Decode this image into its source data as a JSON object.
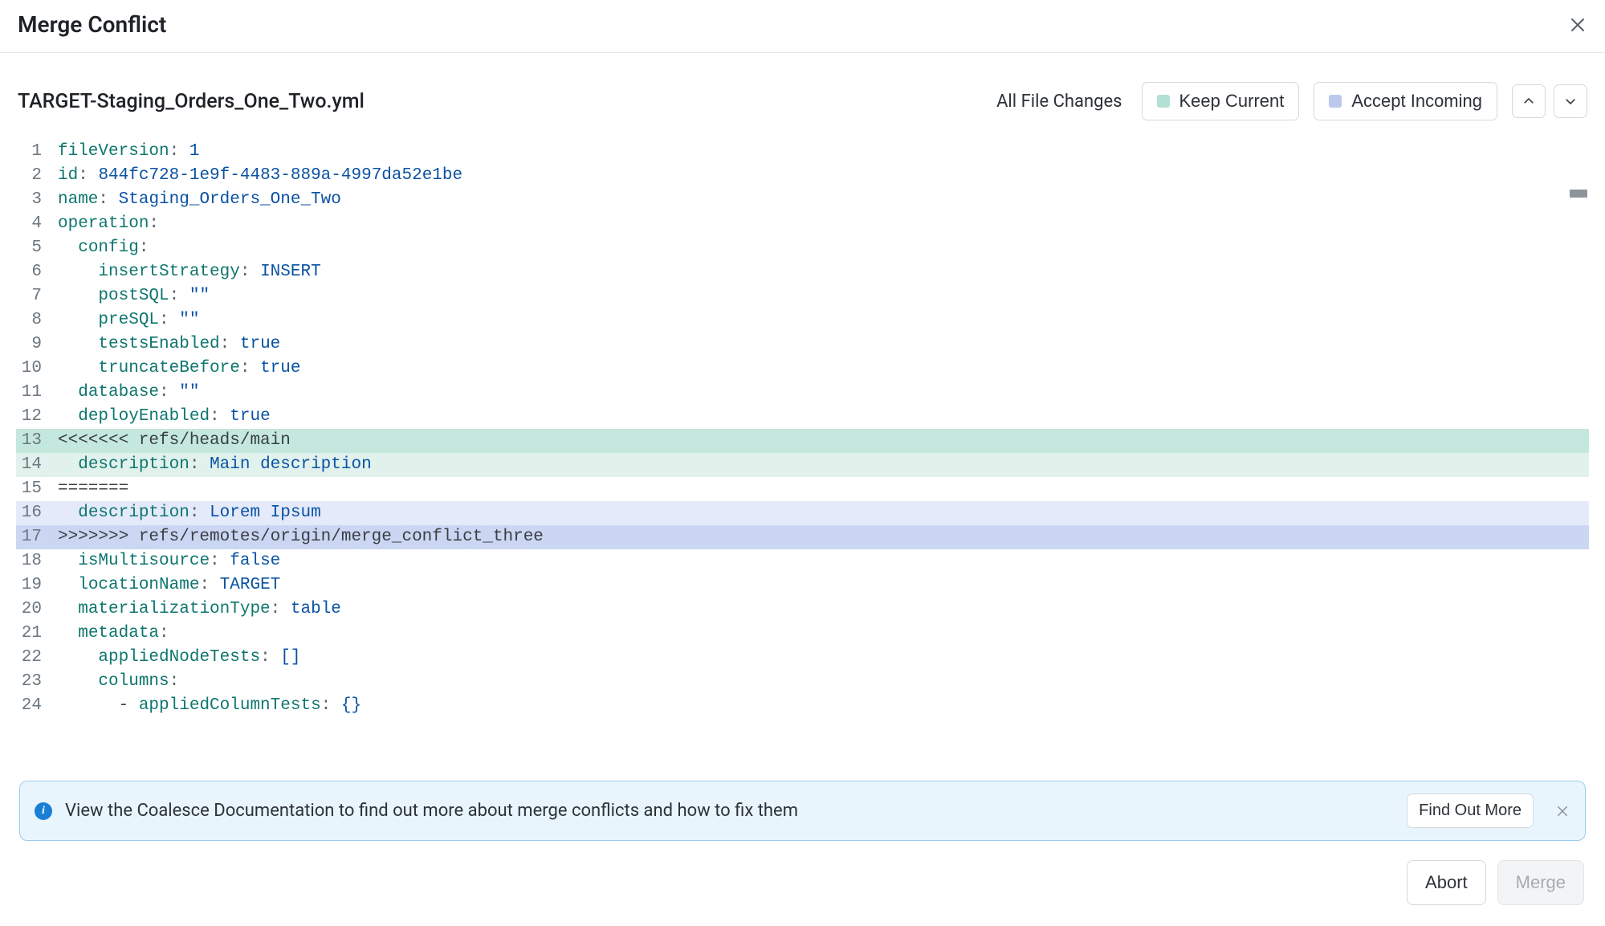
{
  "dialog": {
    "title": "Merge Conflict"
  },
  "file": {
    "name": "TARGET-Staging_Orders_One_Two.yml"
  },
  "actions": {
    "all_file_changes": "All File Changes",
    "keep_current": "Keep Current",
    "accept_incoming": "Accept Incoming"
  },
  "colors": {
    "current_swatch": "#b4dfd4",
    "incoming_swatch": "#bcc9ed",
    "current_head_bg": "#c5e8de",
    "current_body_bg": "#e1f2ed",
    "incoming_body_bg": "#e4eafa",
    "incoming_head_bg": "#cbd6f2"
  },
  "code_lines": [
    {
      "n": 1,
      "hl": "",
      "tokens": [
        [
          "key",
          "fileVersion"
        ],
        [
          "punct",
          ": "
        ],
        [
          "num",
          "1"
        ]
      ]
    },
    {
      "n": 2,
      "hl": "",
      "tokens": [
        [
          "key",
          "id"
        ],
        [
          "punct",
          ": "
        ],
        [
          "val",
          "844fc728-1e9f-4483-889a-4997da52e1be"
        ]
      ]
    },
    {
      "n": 3,
      "hl": "",
      "tokens": [
        [
          "key",
          "name"
        ],
        [
          "punct",
          ": "
        ],
        [
          "val",
          "Staging_Orders_One_Two"
        ]
      ]
    },
    {
      "n": 4,
      "hl": "",
      "tokens": [
        [
          "key",
          "operation"
        ],
        [
          "punct",
          ":"
        ]
      ]
    },
    {
      "n": 5,
      "hl": "",
      "tokens": [
        [
          "plain",
          "  "
        ],
        [
          "key",
          "config"
        ],
        [
          "punct",
          ":"
        ]
      ]
    },
    {
      "n": 6,
      "hl": "",
      "tokens": [
        [
          "plain",
          "    "
        ],
        [
          "key",
          "insertStrategy"
        ],
        [
          "punct",
          ": "
        ],
        [
          "val",
          "INSERT"
        ]
      ]
    },
    {
      "n": 7,
      "hl": "",
      "tokens": [
        [
          "plain",
          "    "
        ],
        [
          "key",
          "postSQL"
        ],
        [
          "punct",
          ": "
        ],
        [
          "val",
          "\"\""
        ]
      ]
    },
    {
      "n": 8,
      "hl": "",
      "tokens": [
        [
          "plain",
          "    "
        ],
        [
          "key",
          "preSQL"
        ],
        [
          "punct",
          ": "
        ],
        [
          "val",
          "\"\""
        ]
      ]
    },
    {
      "n": 9,
      "hl": "",
      "tokens": [
        [
          "plain",
          "    "
        ],
        [
          "key",
          "testsEnabled"
        ],
        [
          "punct",
          ": "
        ],
        [
          "bool",
          "true"
        ]
      ]
    },
    {
      "n": 10,
      "hl": "",
      "tokens": [
        [
          "plain",
          "    "
        ],
        [
          "key",
          "truncateBefore"
        ],
        [
          "punct",
          ": "
        ],
        [
          "bool",
          "true"
        ]
      ]
    },
    {
      "n": 11,
      "hl": "",
      "tokens": [
        [
          "plain",
          "  "
        ],
        [
          "key",
          "database"
        ],
        [
          "punct",
          ": "
        ],
        [
          "val",
          "\"\""
        ]
      ]
    },
    {
      "n": 12,
      "hl": "",
      "tokens": [
        [
          "plain",
          "  "
        ],
        [
          "key",
          "deployEnabled"
        ],
        [
          "punct",
          ": "
        ],
        [
          "bool",
          "true"
        ]
      ]
    },
    {
      "n": 13,
      "hl": "hl-current-head",
      "tokens": [
        [
          "marker",
          "<<<<<<< refs/heads/main"
        ]
      ]
    },
    {
      "n": 14,
      "hl": "hl-current-body",
      "tokens": [
        [
          "plain",
          "  "
        ],
        [
          "key",
          "description"
        ],
        [
          "punct",
          ": "
        ],
        [
          "val",
          "Main description"
        ]
      ]
    },
    {
      "n": 15,
      "hl": "",
      "tokens": [
        [
          "marker",
          "======="
        ]
      ]
    },
    {
      "n": 16,
      "hl": "hl-incoming-body",
      "tokens": [
        [
          "plain",
          "  "
        ],
        [
          "key",
          "description"
        ],
        [
          "punct",
          ": "
        ],
        [
          "val",
          "Lorem Ipsum"
        ]
      ]
    },
    {
      "n": 17,
      "hl": "hl-incoming-head",
      "tokens": [
        [
          "marker",
          ">>>>>>> refs/remotes/origin/merge_conflict_three"
        ]
      ]
    },
    {
      "n": 18,
      "hl": "",
      "tokens": [
        [
          "plain",
          "  "
        ],
        [
          "key",
          "isMultisource"
        ],
        [
          "punct",
          ": "
        ],
        [
          "bool",
          "false"
        ]
      ]
    },
    {
      "n": 19,
      "hl": "",
      "tokens": [
        [
          "plain",
          "  "
        ],
        [
          "key",
          "locationName"
        ],
        [
          "punct",
          ": "
        ],
        [
          "val",
          "TARGET"
        ]
      ]
    },
    {
      "n": 20,
      "hl": "",
      "tokens": [
        [
          "plain",
          "  "
        ],
        [
          "key",
          "materializationType"
        ],
        [
          "punct",
          ": "
        ],
        [
          "val",
          "table"
        ]
      ]
    },
    {
      "n": 21,
      "hl": "",
      "tokens": [
        [
          "plain",
          "  "
        ],
        [
          "key",
          "metadata"
        ],
        [
          "punct",
          ":"
        ]
      ]
    },
    {
      "n": 22,
      "hl": "",
      "tokens": [
        [
          "plain",
          "    "
        ],
        [
          "key",
          "appliedNodeTests"
        ],
        [
          "punct",
          ": "
        ],
        [
          "val",
          "[]"
        ]
      ]
    },
    {
      "n": 23,
      "hl": "",
      "tokens": [
        [
          "plain",
          "    "
        ],
        [
          "key",
          "columns"
        ],
        [
          "punct",
          ":"
        ]
      ]
    },
    {
      "n": 24,
      "hl": "",
      "tokens": [
        [
          "plain",
          "      - "
        ],
        [
          "key",
          "appliedColumnTests"
        ],
        [
          "punct",
          ": "
        ],
        [
          "val",
          "{}"
        ]
      ]
    }
  ],
  "banner": {
    "text": "View the Coalesce Documentation to find out more about merge conflicts and how to fix them",
    "find_out_more": "Find Out More"
  },
  "footer": {
    "abort": "Abort",
    "merge": "Merge"
  }
}
